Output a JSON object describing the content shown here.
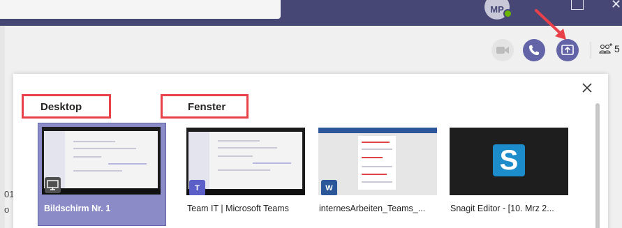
{
  "titlebar": {
    "avatar_initials": "MP",
    "close_glyph": "✕"
  },
  "toolbar": {
    "video_icon": "video-camera-icon",
    "call_icon": "phone-icon",
    "share_icon": "share-screen-icon",
    "participants_count": "5"
  },
  "left_clip": [
    "01",
    "o"
  ],
  "share_panel": {
    "close_glyph": "✕",
    "desktop_label": "Desktop",
    "windows_label": "Fenster",
    "tiles": [
      {
        "caption": "Bildschirm Nr. 1",
        "selected": true
      },
      {
        "caption": "Team IT | Microsoft Teams"
      },
      {
        "caption": "internesArbeiten_Teams_...",
        "badge": "W"
      },
      {
        "caption": "Snagit Editor - [10. Mrz 2...",
        "logo": "S"
      }
    ]
  },
  "colors": {
    "teams_purple": "#6264a7",
    "titlebar": "#464775",
    "highlight_red": "#e8414a",
    "selected_tile": "#8b8cc7"
  }
}
